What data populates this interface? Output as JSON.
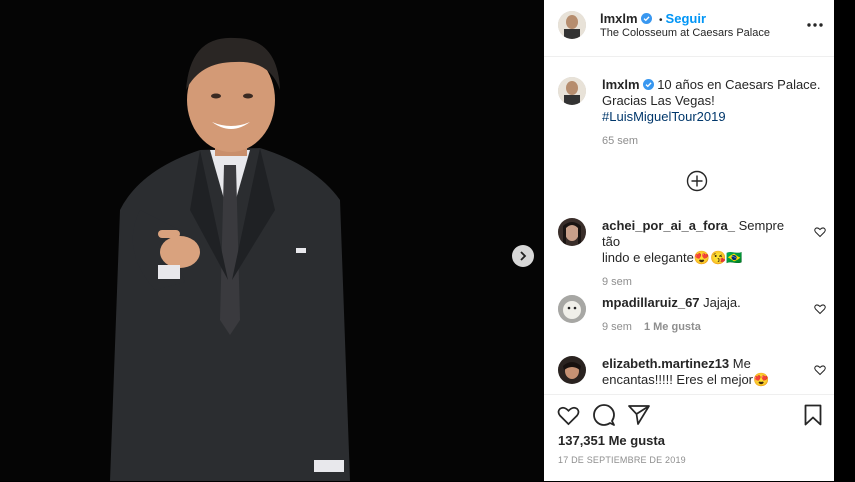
{
  "header": {
    "username": "lmxlm",
    "separator": "•",
    "follow_label": "Seguir",
    "location": "The Colosseum at Caesars Palace",
    "more_icon": "more-horizontal-icon"
  },
  "caption": {
    "username": "lmxlm",
    "text_line1": "10 años en Caesars Palace.",
    "text_line2": "Gracias Las Vegas!",
    "hashtag": "#LuisMiguelTour2019",
    "time": "65 sem"
  },
  "load_more_icon": "plus-circle-icon",
  "comments": [
    {
      "username": "achei_por_ai_a_fora_",
      "text_a": "Sempre tão",
      "text_b": "lindo e elegante😍😘🇧🇷",
      "time": "9 sem",
      "likes": ""
    },
    {
      "username": "mpadillaruiz_67",
      "text_a": "Jajaja.",
      "text_b": "",
      "time": "9 sem",
      "likes": "1 Me gusta"
    },
    {
      "username": "elizabeth.martinez13",
      "text_a": "Me",
      "text_b": "encantas!!!!! Eres el mejor😍",
      "time": "",
      "likes": ""
    }
  ],
  "actions": {
    "like_icon": "heart-icon",
    "comment_icon": "comment-icon",
    "share_icon": "send-icon",
    "save_icon": "bookmark-icon",
    "likes_count": "137,351 Me gusta",
    "date": "17 DE SEPTIEMBRE DE 2019"
  },
  "colors": {
    "verified": "#3897f0",
    "follow": "#0095f6",
    "hashtag": "#00376b",
    "muted": "#8e8e8e"
  }
}
